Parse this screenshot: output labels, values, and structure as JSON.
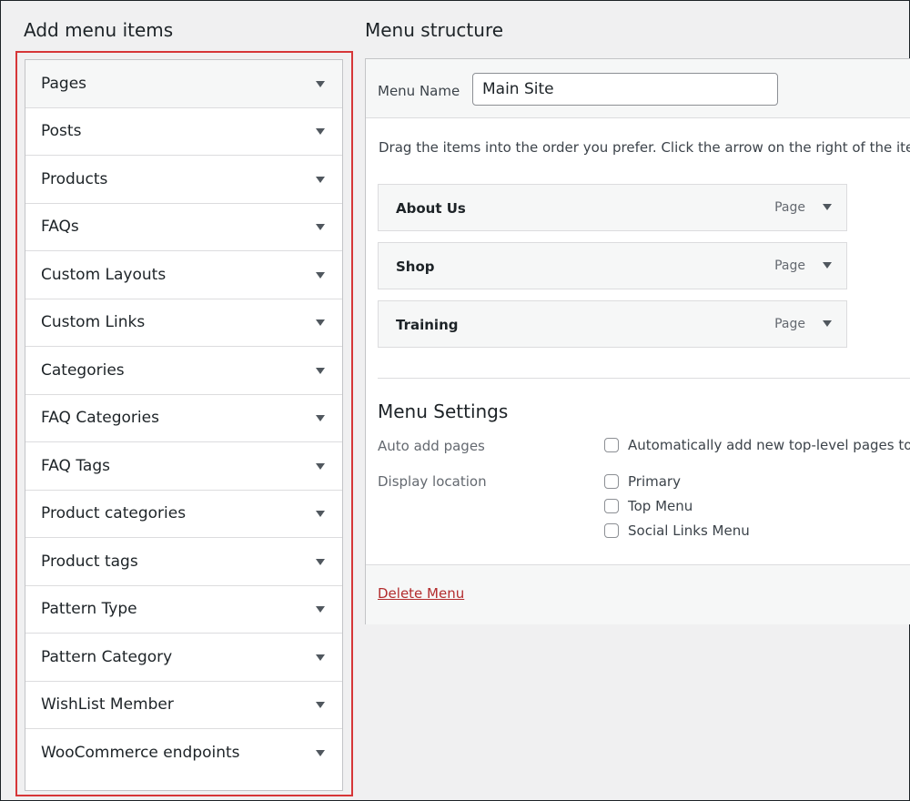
{
  "left": {
    "title": "Add menu items",
    "items": [
      {
        "label": "Pages"
      },
      {
        "label": "Posts"
      },
      {
        "label": "Products"
      },
      {
        "label": "FAQs"
      },
      {
        "label": "Custom Layouts"
      },
      {
        "label": "Custom Links"
      },
      {
        "label": "Categories"
      },
      {
        "label": "FAQ Categories"
      },
      {
        "label": "FAQ Tags"
      },
      {
        "label": "Product categories"
      },
      {
        "label": "Product tags"
      },
      {
        "label": "Pattern Type"
      },
      {
        "label": "Pattern Category"
      },
      {
        "label": "WishList Member"
      },
      {
        "label": "WooCommerce endpoints"
      }
    ],
    "highlight_color": "#d63638"
  },
  "right": {
    "title": "Menu structure",
    "menu_name_label": "Menu Name",
    "menu_name_value": "Main Site",
    "instructions": "Drag the items into the order you prefer. Click the arrow on the right of the item t",
    "menu_items": [
      {
        "title": "About Us",
        "type": "Page"
      },
      {
        "title": "Shop",
        "type": "Page"
      },
      {
        "title": "Training",
        "type": "Page"
      }
    ],
    "settings": {
      "title": "Menu Settings",
      "auto_add_label": "Auto add pages",
      "auto_add_option": "Automatically add new top-level pages to t",
      "display_location_label": "Display location",
      "locations": [
        "Primary",
        "Top Menu",
        "Social Links Menu"
      ]
    },
    "delete_label": "Delete Menu"
  }
}
